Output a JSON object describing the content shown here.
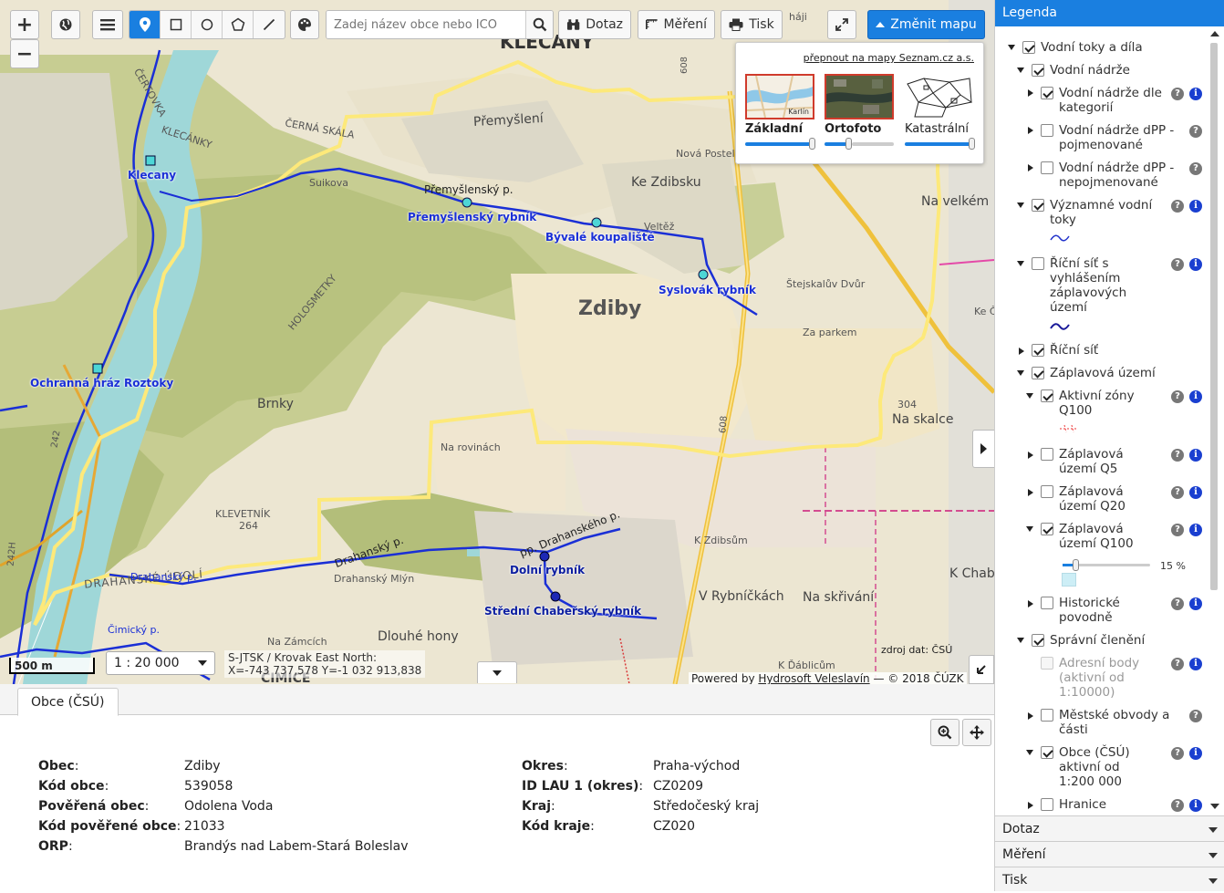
{
  "toolbar": {
    "search_placeholder": "Zadej název obce nebo IČO",
    "dotaz": "Dotaz",
    "mereni": "Měření",
    "tisk": "Tisk",
    "zmenit_mapu": "Změnit mapu"
  },
  "basemaps": {
    "seznam_link": "přepnout na mapy Seznam.cz a.s.",
    "items": [
      {
        "name": "Základní",
        "selected": true,
        "opacity": 1.0,
        "thumb_label": "Karlín"
      },
      {
        "name": "Ortofoto",
        "selected": true,
        "opacity": 0.3
      },
      {
        "name": "Katastrální",
        "selected": false,
        "opacity": 1.0
      }
    ]
  },
  "map": {
    "places": {
      "zdiby": "Zdiby",
      "premysleni": "Přemyšlení",
      "brnky": "Brnky",
      "klecany_top": "KLECANY",
      "klecanky": "KLECÁNKY",
      "cerna_skala": "ČERNÁ SKÁLA",
      "certovka": "ČERTOVKA",
      "holosmetky": "HOLOSMETKY",
      "na_rovinach": "Na rovinách",
      "klevetnik": "KLEVETNÍK",
      "klevetnik_h": "264",
      "drahanske_udoli": "DRAHANSKÉ ÚDOLÍ",
      "drahansky_mlyn": "Drahanský Mlýn",
      "dlouhe_hony": "Dlouhé hony",
      "na_zamcich": "Na Zámcích",
      "cimice": "ČIMICE",
      "ke_zdibsku": "Ke Zdibsku",
      "nova_postel": "Nová Postel",
      "stejskaluv_dvur": "Štejskalův Dvůr",
      "za_parkem": "Za parkem",
      "na_skalce": "Na skalce",
      "na_skalce_h": "304",
      "na_velkem": "Na velkém",
      "ke_zdibsum": "K Zdibsům",
      "v_rybnickach": "V Rybníčkách",
      "na_skrivani": "Na skřivání",
      "k_chabrum": "K Chabr",
      "ke_c": "Ke Č",
      "k_dablicum": "K Ďáblicům",
      "haji": "háji",
      "veltez": "Veltěž",
      "suikova": "Suikova",
      "road_608a": "608",
      "road_608b": "608",
      "road_242": "242",
      "road_242h": "242H",
      "stream_premysl": "Přemyšlenský p.",
      "stream_drah": "pp. Drahanského p.",
      "stream_drahansky": "Drahanský p.",
      "stream_drahansky2": "Drahanský p.",
      "stream_cimicky": "Čimický p."
    },
    "water": {
      "klecany": "Klecany",
      "ochranna_hraz": "Ochranná hráz Roztoky",
      "premyslensky": "Přemyšlenský rybník",
      "byvale": "Bývalé koupaliště",
      "syslovak": "Syslovák rybník",
      "dolni": "Dolní rybník",
      "stredni": "Střední Chabeřský rybník"
    },
    "scale_bar": "500 m",
    "scale": "1 : 20 000",
    "coords_line1": "S-JTSK / Krovak East North:",
    "coords_line2": "X=-743 737,578 Y=-1 032 913,838",
    "zdroj": "zdroj dat: ČSÚ",
    "powered_prefix": "Powered by",
    "powered_link": "Hydrosoft Veleslavín",
    "powered_suffix": "— © 2018 ČÚZK"
  },
  "panel": {
    "tab": "Obce (ČSÚ)",
    "left": [
      {
        "k": "Obec",
        "v": "Zdiby"
      },
      {
        "k": "Kód obce",
        "v": "539058"
      },
      {
        "k": "Pověřená obec",
        "v": "Odolena Voda"
      },
      {
        "k": "Kód pověřené obce",
        "v": "21033"
      },
      {
        "k": "ORP",
        "v": "Brandýs nad Labem-Stará Boleslav"
      }
    ],
    "right": [
      {
        "k": "Okres",
        "v": "Praha-východ"
      },
      {
        "k": "ID LAU 1 (okres)",
        "v": "CZ0209"
      },
      {
        "k": "Kraj",
        "v": "Středočeský kraj"
      },
      {
        "k": "Kód kraje",
        "v": "CZ020"
      }
    ]
  },
  "legend": {
    "title": "Legenda",
    "items": [
      {
        "label": "Vodní toky a díla",
        "checked": true,
        "expanded": true
      },
      {
        "label": "Vodní nádrže",
        "checked": true,
        "expanded": true
      },
      {
        "label": "Vodní nádrže dle kategorií",
        "checked": true,
        "expanded": false
      },
      {
        "label": "Vodní nádrže dPP - pojmenované",
        "checked": false,
        "expanded": false
      },
      {
        "label": "Vodní nádrže dPP - nepojmenované",
        "checked": false,
        "expanded": false
      },
      {
        "label": "Významné vodní toky",
        "checked": true,
        "expanded": true
      },
      {
        "label": "Říční síť s vyhlášením záplavových území",
        "checked": false,
        "expanded": true
      },
      {
        "label": "Říční síť",
        "checked": true,
        "expanded": false
      },
      {
        "label": "Záplavová území",
        "checked": true,
        "expanded": true
      },
      {
        "label": "Aktivní zóny Q100",
        "checked": true,
        "expanded": true
      },
      {
        "label": "Záplavová území Q5",
        "checked": false,
        "expanded": false
      },
      {
        "label": "Záplavová území Q20",
        "checked": false,
        "expanded": false
      },
      {
        "label": "Záplavová území Q100",
        "checked": true,
        "expanded": true
      },
      {
        "label": "Historické povodně",
        "checked": false,
        "expanded": false
      },
      {
        "label": "Správní členění",
        "checked": true,
        "expanded": true
      },
      {
        "label": "Adresní body (aktivní od 1:10000)",
        "checked": false,
        "disabled": true
      },
      {
        "label": "Městské obvody a části",
        "checked": false,
        "expanded": false
      },
      {
        "label": "Obce (ČSÚ) aktivní od 1:200 000",
        "checked": true,
        "expanded": false
      },
      {
        "label": "Hranice",
        "checked": false,
        "expanded": false
      }
    ],
    "opacity_value": 0.15,
    "opacity_label": "15 %",
    "sections": [
      "Dotaz",
      "Měření",
      "Tisk"
    ]
  },
  "colors": {
    "accent": "#1a7fe0",
    "boundary": "#ffe97a",
    "stream": "#1a2fd6",
    "river": "#5bc6c6",
    "forest": "#b3c27e"
  }
}
